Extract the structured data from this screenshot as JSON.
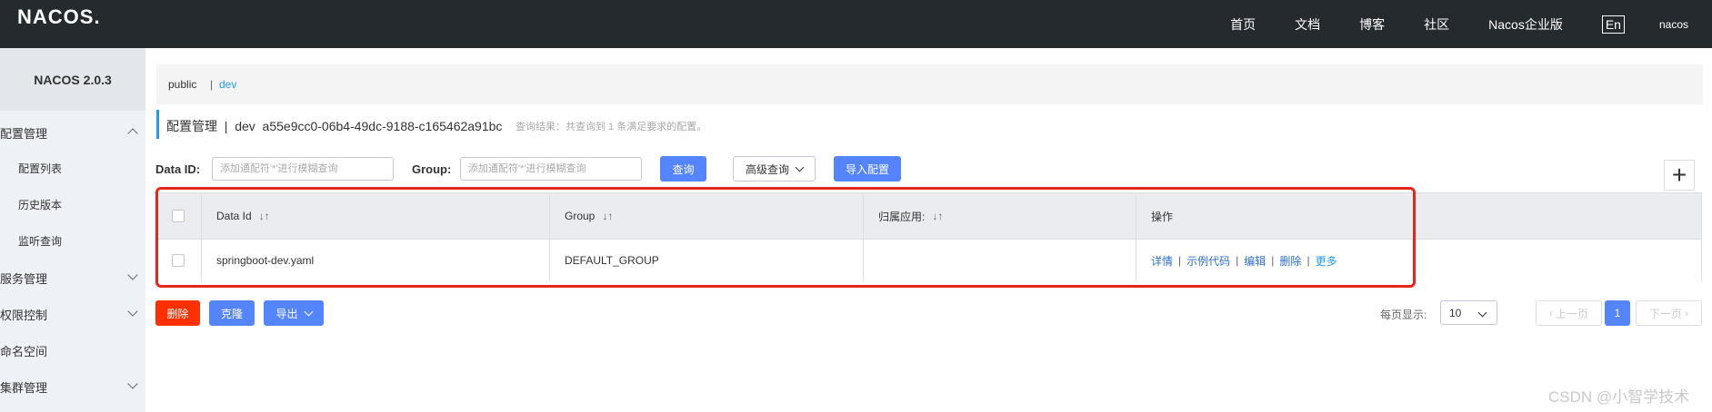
{
  "topbar": {
    "logo": "NACOS.",
    "nav": [
      "首页",
      "文档",
      "博客",
      "社区",
      "Nacos企业版"
    ],
    "lang": "En",
    "user": "nacos"
  },
  "sidebar": {
    "version": "NACOS 2.0.3",
    "config_mgmt": "配置管理",
    "config_sub": [
      "配置列表",
      "历史版本",
      "监听查询"
    ],
    "service_mgmt": "服务管理",
    "permission": "权限控制",
    "namespace": "命名空间",
    "cluster": "集群管理"
  },
  "namespace_bar": {
    "public": "public",
    "sep": "|",
    "dev": "dev"
  },
  "header": {
    "title": "配置管理  |  dev  a55e9cc0-06b4-49dc-9188-c165462a91bc",
    "result": "查询结果：共查询到 1 条满足要求的配置。"
  },
  "search": {
    "dataid_label": "Data ID:",
    "dataid_placeholder": "添加通配符'*'进行模糊查询",
    "group_label": "Group:",
    "group_placeholder": "添加通配符'*'进行模糊查询",
    "query": "查询",
    "advanced": "高级查询",
    "import": "导入配置",
    "add": "+"
  },
  "table": {
    "headers": [
      "Data Id",
      "Group",
      "归属应用:",
      "操作"
    ],
    "sort_icon": "↓↑",
    "rows": [
      {
        "data_id": "springboot-dev.yaml",
        "group": "DEFAULT_GROUP",
        "app": "",
        "ops": [
          "详情",
          "示例代码",
          "编辑",
          "删除",
          "更多"
        ]
      }
    ]
  },
  "actions": {
    "delete": "删除",
    "clone": "克隆",
    "export": "导出"
  },
  "pagination": {
    "per_page_label": "每页显示:",
    "per_page": "10",
    "prev": "上一页",
    "current": "1",
    "next": "下一页"
  },
  "watermark": "CSDN @小智学技术",
  "colors": {
    "topbar": "#252a2f",
    "primary": "#5584ff",
    "danger": "#ff3000",
    "link": "#2e6ed8",
    "highlight": "#e6251c"
  }
}
